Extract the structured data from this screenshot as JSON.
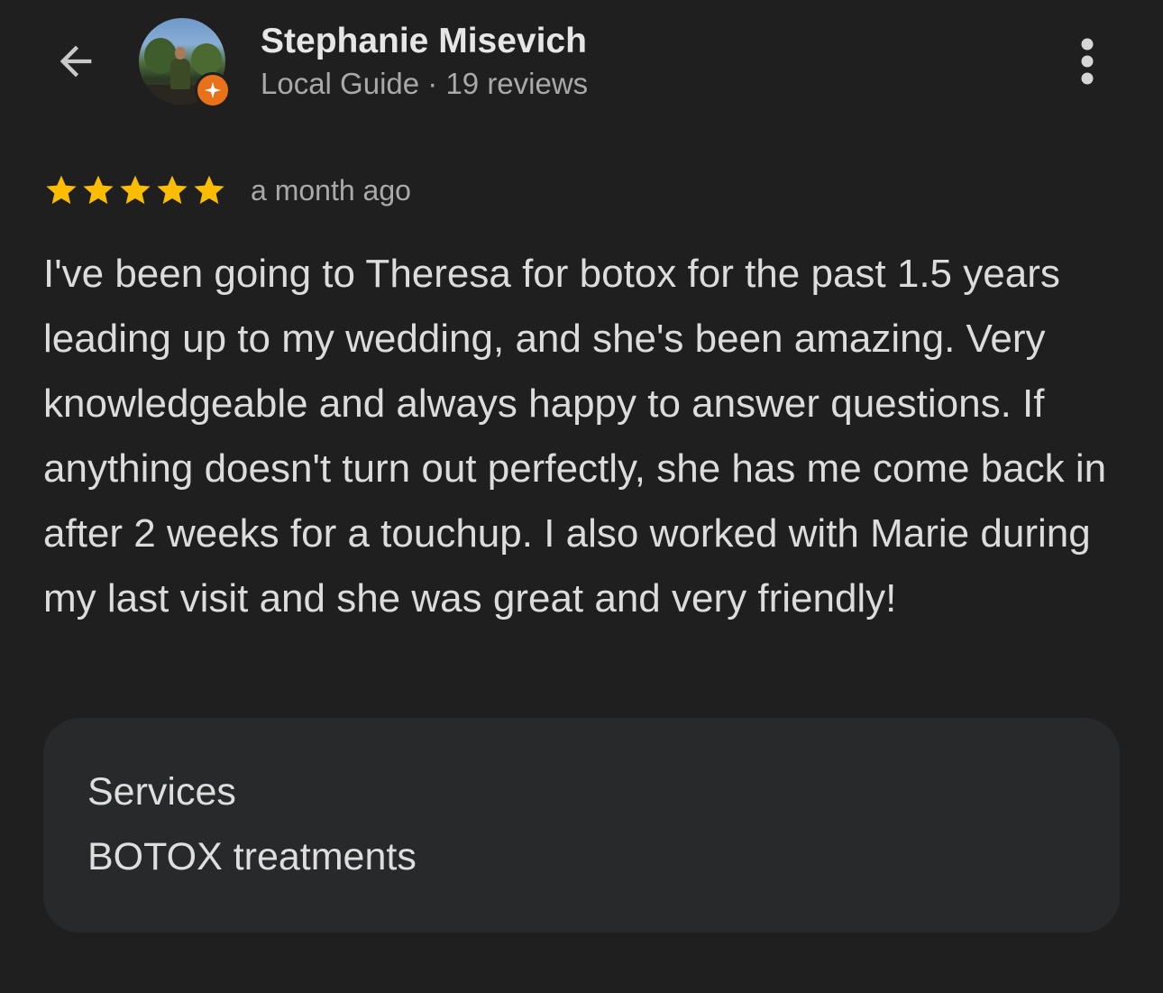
{
  "header": {
    "name": "Stephanie Misevich",
    "subline": "Local Guide · 19 reviews"
  },
  "review": {
    "rating": 5,
    "max_rating": 5,
    "time": "a month ago",
    "text": "I've been going to Theresa for botox for the past 1.5 years leading up to my wedding, and she's been amazing. Very knowledgeable and always happy to answer questions. If anything doesn't turn out perfectly, she has me come back in after 2 weeks for a touchup. I also worked with Marie during my last visit and she was great and very friendly!"
  },
  "services": {
    "title": "Services",
    "value": "BOTOX treatments"
  },
  "colors": {
    "background": "#1f1f1f",
    "star": "#fbbc04",
    "guide_badge": "#e8711a",
    "card": "#28292b"
  },
  "icons": {
    "back": "arrow-back-icon",
    "more": "more-vert-icon",
    "badge": "local-guide-badge-icon",
    "star": "star-icon"
  }
}
